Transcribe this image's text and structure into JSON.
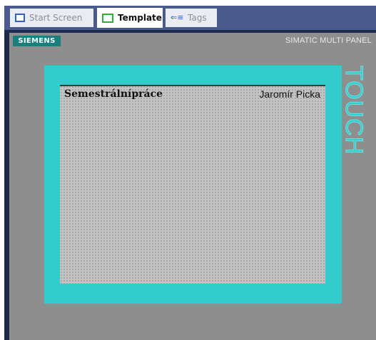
{
  "tabs": [
    {
      "label": "Start Screen",
      "icon": "screen-icon",
      "active": false
    },
    {
      "label": "Template",
      "icon": "template-icon",
      "active": true
    },
    {
      "label": "Tags",
      "icon": "tags-icon",
      "active": false
    }
  ],
  "device": {
    "brand_logo": "SIEMENS",
    "model_label": "SIMATIC MULTI PANEL",
    "touch_label": "TOUCH",
    "colors": {
      "frame": "#1f2a4a",
      "panel": "#8e8e8e",
      "bezel": "#33cccc",
      "logo_bg": "#1a7f7f"
    }
  },
  "screen": {
    "title": "Semestrálnípráce",
    "author": "Jaromír Picka"
  }
}
